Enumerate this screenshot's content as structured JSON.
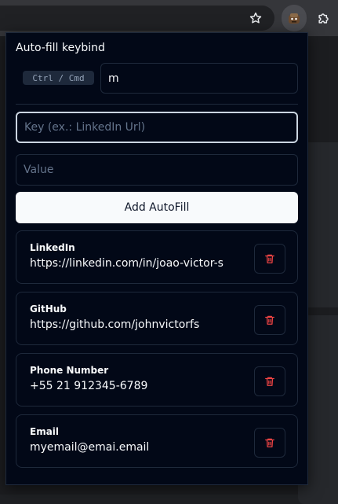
{
  "browser": {
    "icons": [
      "star-icon",
      "cookie-extension-icon",
      "puzzle-icon"
    ]
  },
  "popup": {
    "keybind_title": "Auto-fill keybind",
    "modifier_label": "Ctrl / Cmd",
    "key_value": "m",
    "key_field_placeholder": "Key (ex.: LinkedIn Url)",
    "value_field_placeholder": "Value",
    "add_button_label": "Add AutoFill",
    "items": [
      {
        "label": "LinkedIn",
        "value": "https://linkedin.com/in/joao-victor-s"
      },
      {
        "label": "GitHub",
        "value": "https://github.com/johnvictorfs"
      },
      {
        "label": "Phone Number",
        "value": "+55 21 912345-6789"
      },
      {
        "label": "Email",
        "value": "myemail@emai.email"
      }
    ],
    "colors": {
      "background": "#020817",
      "border": "#1e293b",
      "button_bg": "#f8fafc",
      "delete_icon": "#ef4444"
    }
  }
}
